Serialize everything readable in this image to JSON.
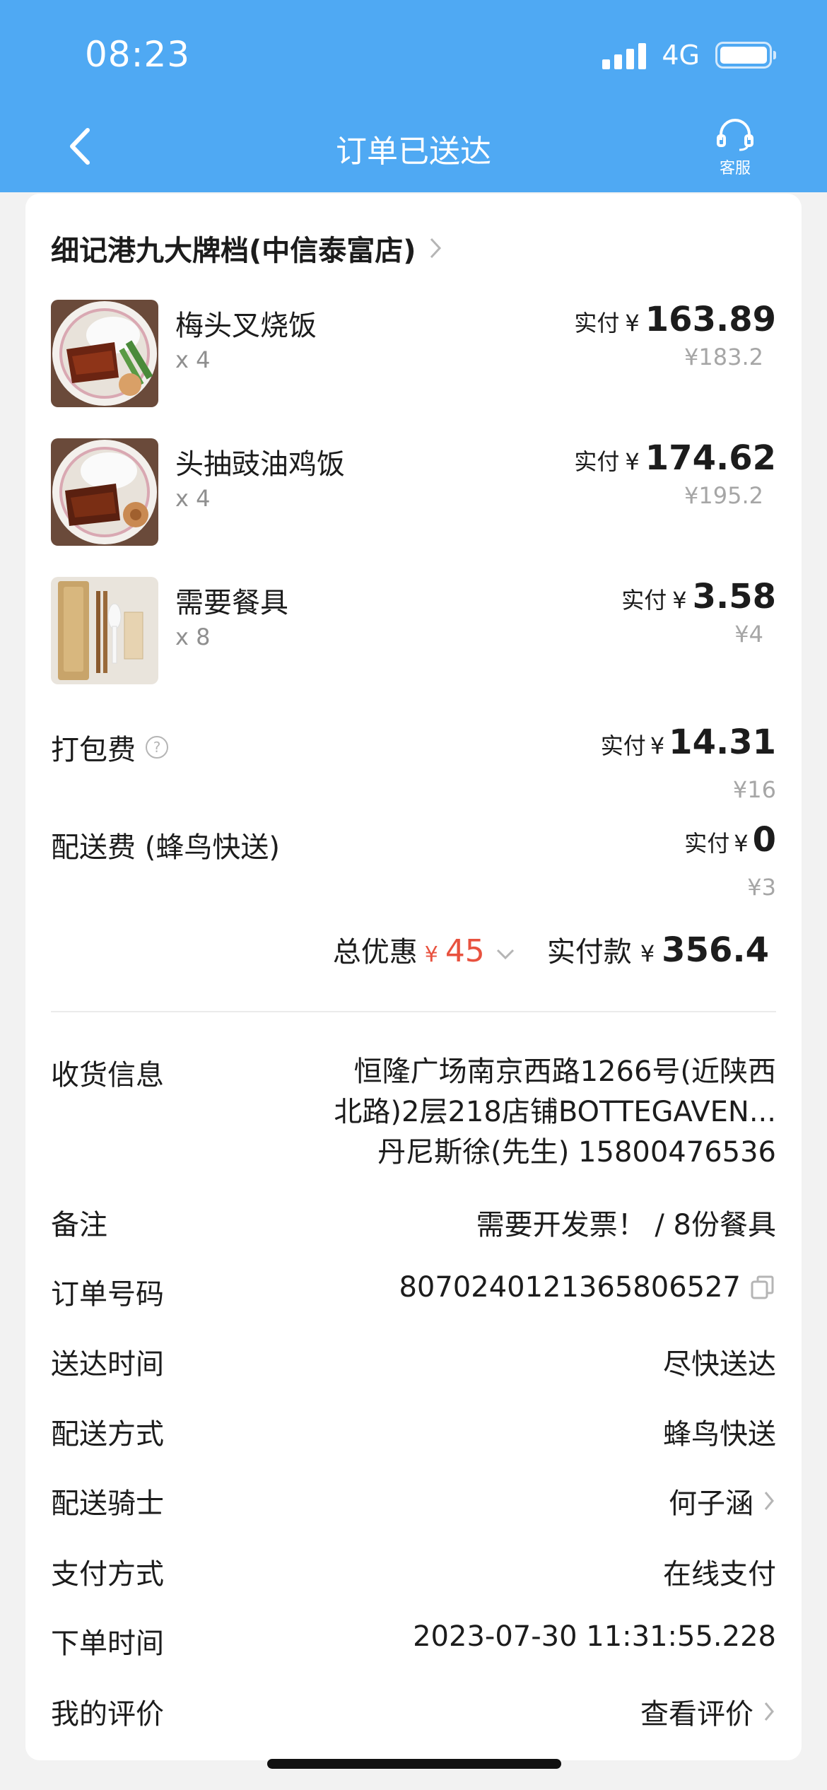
{
  "status_bar": {
    "time": "08:23",
    "network": "4G"
  },
  "nav": {
    "title": "订单已送达",
    "service_label": "客服"
  },
  "store": {
    "name": "细记港九大牌档(中信泰富店)"
  },
  "items": [
    {
      "name": "梅头叉烧饭",
      "qty": "x 4",
      "paid_label": "实付",
      "yen": "¥",
      "paid": "163.89",
      "original": "¥183.2"
    },
    {
      "name": "头抽豉油鸡饭",
      "qty": "x 4",
      "paid_label": "实付",
      "yen": "¥",
      "paid": "174.62",
      "original": "¥195.2"
    },
    {
      "name": "需要餐具",
      "qty": "x 8",
      "paid_label": "实付",
      "yen": "¥",
      "paid": "3.58",
      "original": "¥4"
    }
  ],
  "fees": [
    {
      "label": "打包费",
      "has_help": true,
      "paid_label": "实付",
      "yen": "¥",
      "paid": "14.31",
      "original": "¥16"
    },
    {
      "label": "配送费 (蜂鸟快送)",
      "has_help": false,
      "paid_label": "实付",
      "yen": "¥",
      "paid": "0",
      "original": "¥3"
    }
  ],
  "summary": {
    "discount_label": "总优惠",
    "discount_yen": "¥",
    "discount": "45",
    "total_label": "实付款",
    "total_yen": "¥",
    "total": "356.4"
  },
  "info": {
    "address": {
      "label": "收货信息",
      "line1": "恒隆广场南京西路1266号(近陕西",
      "line2": "北路)2层218店铺BOTTEGAVEN...",
      "line3": "丹尼斯徐(先生) 15800476536"
    },
    "rows": [
      {
        "label": "备注",
        "value": "需要开发票！ / 8份餐具"
      },
      {
        "label": "订单号码",
        "value": "8070240121365806527"
      },
      {
        "label": "送达时间",
        "value": "尽快送达"
      },
      {
        "label": "配送方式",
        "value": "蜂鸟快送"
      },
      {
        "label": "配送骑士",
        "value": "何子涵"
      },
      {
        "label": "支付方式",
        "value": "在线支付"
      },
      {
        "label": "下单时间",
        "value": "2023-07-30 11:31:55.228"
      },
      {
        "label": "我的评价",
        "value": "查看评价"
      }
    ]
  },
  "colors": {
    "header": "#4fa9f3",
    "discount": "#e8523f",
    "muted": "#a6a6a6"
  }
}
